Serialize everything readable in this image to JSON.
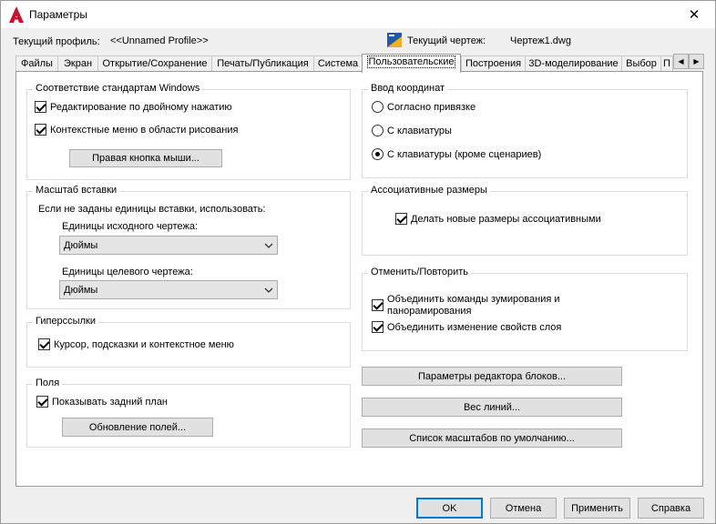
{
  "window": {
    "title": "Параметры",
    "close_symbol": "✕",
    "icon": "autocad-icon"
  },
  "profile": {
    "label": "Текущий профиль:",
    "value": "<<Unnamed Profile>>",
    "drawing_label": "Текущий чертеж:",
    "drawing_value": "Чертеж1.dwg",
    "drawing_icon": "drawing-file-icon"
  },
  "tabs": [
    {
      "label": "Файлы"
    },
    {
      "label": "Экран"
    },
    {
      "label": "Открытие/Сохранение"
    },
    {
      "label": "Печать/Публикация"
    },
    {
      "label": "Система"
    },
    {
      "label": "Пользовательские"
    },
    {
      "label": "Построения"
    },
    {
      "label": "3D-моделирование"
    },
    {
      "label": "Выбор"
    },
    {
      "label": "П"
    }
  ],
  "tab_scroll": {
    "left": "◀",
    "right": "▶"
  },
  "windows_std": {
    "title": "Соответствие стандартам Windows",
    "double_click": "Редактирование по двойному нажатию",
    "context_menu": "Контекстные меню в области рисования",
    "right_click_btn": "Правая кнопка мыши..."
  },
  "insert_scale": {
    "title": "Масштаб вставки",
    "hint": "Если не заданы единицы вставки, использовать:",
    "source_label": "Единицы исходного чертежа:",
    "source_value": "Дюймы",
    "target_label": "Единицы целевого чертежа:",
    "target_value": "Дюймы"
  },
  "hyperlinks": {
    "title": "Гиперссылки",
    "cursor": "Курсор, подсказки и контекстное меню"
  },
  "fields": {
    "title": "Поля",
    "show_bg": "Показывать задний план",
    "update_btn": "Обновление полей..."
  },
  "coord_input": {
    "title": "Ввод координат",
    "snap": "Согласно привязке",
    "keyboard": "С клавиатуры",
    "keyboard_except": "С клавиатуры (кроме сценариев)"
  },
  "assoc_dims": {
    "title": "Ассоциативные размеры",
    "make_assoc": "Делать новые размеры ассоциативными"
  },
  "undo_redo": {
    "title": "Отменить/Повторить",
    "combine_zoom": "Объединить команды зумирования и панорамирования",
    "combine_layer": "Объединить изменение свойств слоя"
  },
  "right_buttons": {
    "block_editor": "Параметры редактора блоков...",
    "lineweight": "Вес линий...",
    "scale_list": "Список масштабов по умолчанию..."
  },
  "footer": {
    "ok": "OK",
    "cancel": "Отмена",
    "apply": "Применить",
    "help": "Справка"
  }
}
